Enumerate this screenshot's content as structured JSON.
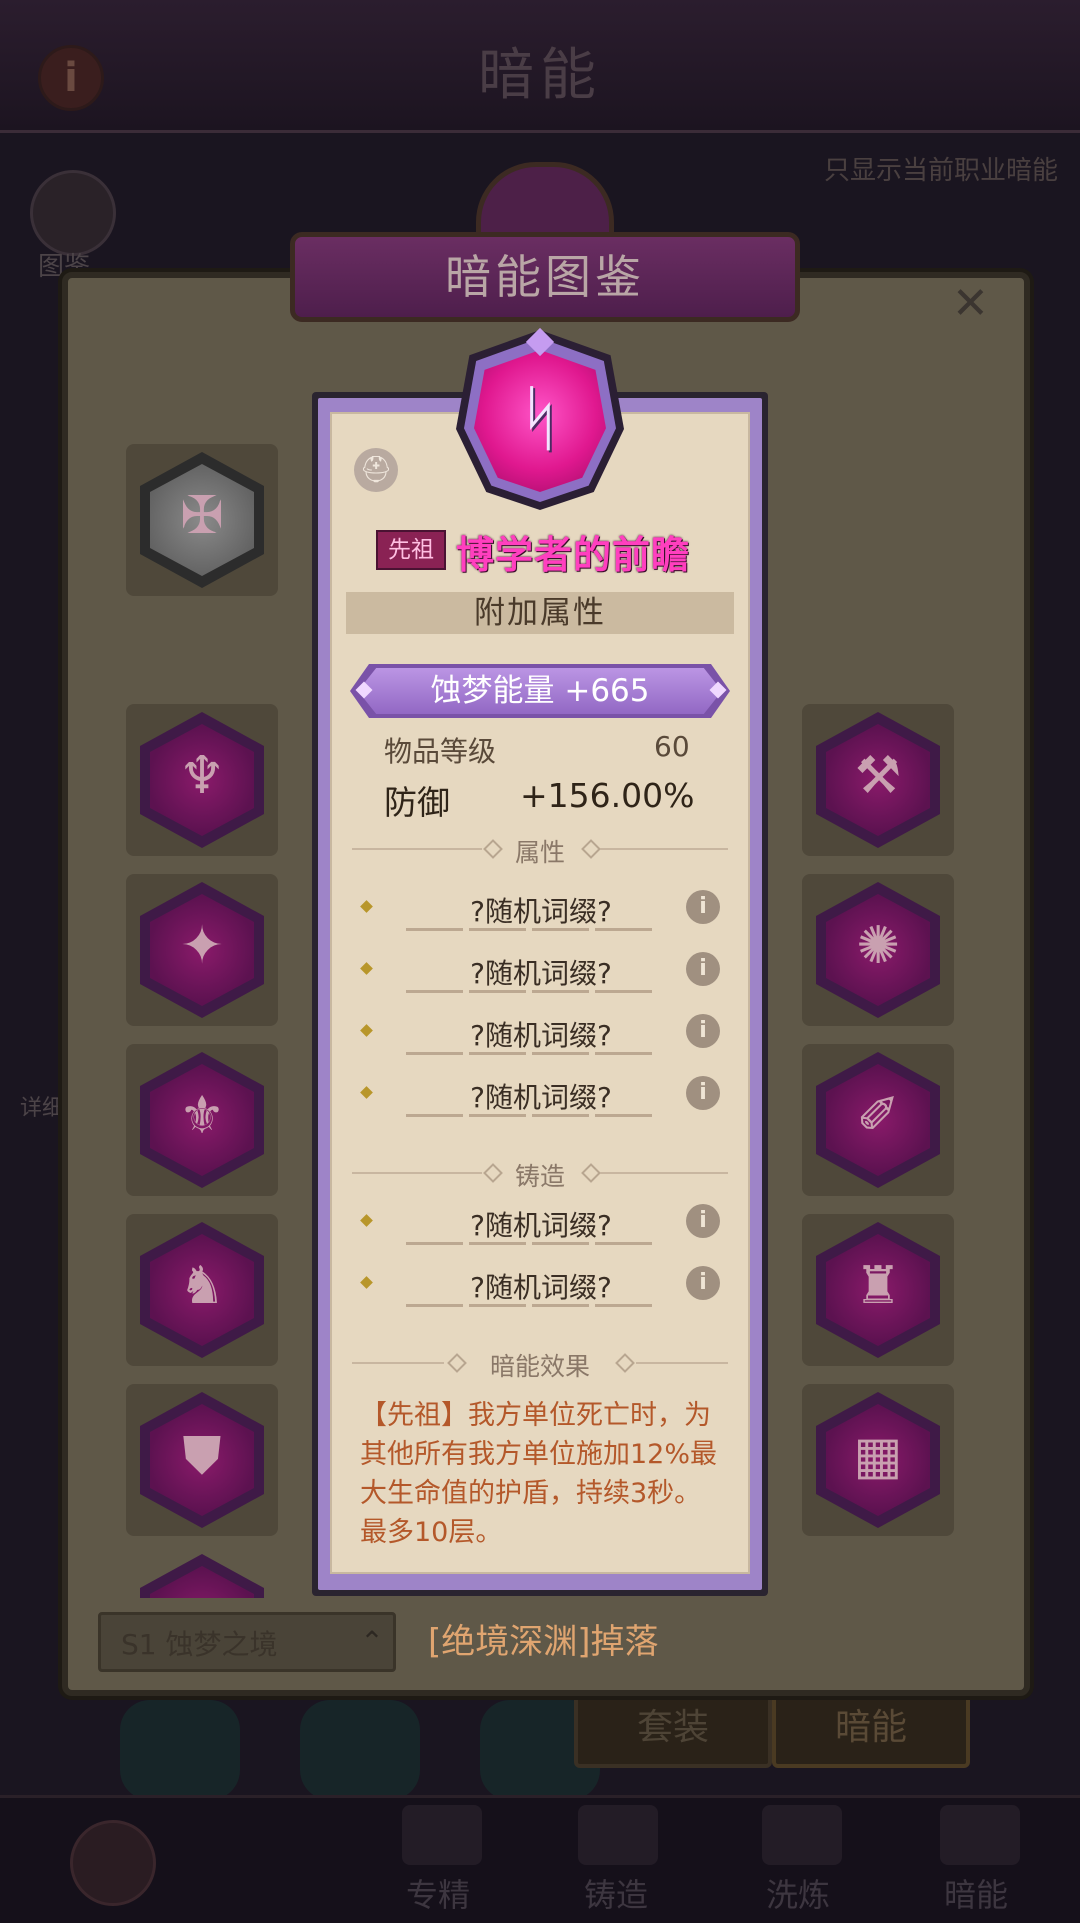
{
  "header": {
    "title": "暗能",
    "info_icon": "i"
  },
  "filter_label": "只显示当前职业暗能",
  "sidebar": {
    "book_label": "图鉴",
    "detail_label": "详细"
  },
  "codex": {
    "title": "暗能图鉴",
    "close_icon": "✕",
    "source_select": "S1 蚀梦之境",
    "source_caret": "⌃",
    "drop_text": "[绝境深渊]掉落"
  },
  "bottom_tabs": {
    "set_label": "套装",
    "dark_energy_label": "暗能"
  },
  "bottom_nav": [
    {
      "label": "专精",
      "icon": "tree-icon"
    },
    {
      "label": "铸造",
      "icon": "anvil-icon"
    },
    {
      "label": "洗炼",
      "icon": "triquetra-icon"
    },
    {
      "label": "暗能",
      "icon": "dark-energy-icon"
    }
  ],
  "grid_icons": {
    "left": [
      "✠",
      "♆",
      "✦",
      "⚜",
      "♞",
      "⛊",
      "◆"
    ],
    "right": [
      "⚒",
      "✺",
      "✐",
      "♜",
      "▦"
    ]
  },
  "item": {
    "rarity": "先祖",
    "name": "博学者的前瞻",
    "glyph": "ᛋ",
    "slot_icon": "⛑",
    "section_title": "附加属性",
    "energy": "蚀梦能量  +665",
    "item_level_label": "物品等级",
    "item_level_value": "60",
    "defense_label": "防御",
    "defense_value": "+156.00%",
    "attributes_title": "属性",
    "attributes": [
      "?随机词缀?",
      "?随机词缀?",
      "?随机词缀?",
      "?随机词缀?"
    ],
    "forge_title": "铸造",
    "forge": [
      "?随机词缀?",
      "?随机词缀?"
    ],
    "effect_title": "暗能效果",
    "effect_text": "【先祖】我方单位死亡时，为其他所有我方单位施加12%最大生命值的护盾，持续3秒。最多10层。",
    "info_icon": "i"
  },
  "colors": {
    "card_border": "#9e84c8",
    "parchment": "#e6d8c0",
    "item_name": "#ff3fbf",
    "effect_text": "#b4582a",
    "drop_text": "#e0a570"
  }
}
